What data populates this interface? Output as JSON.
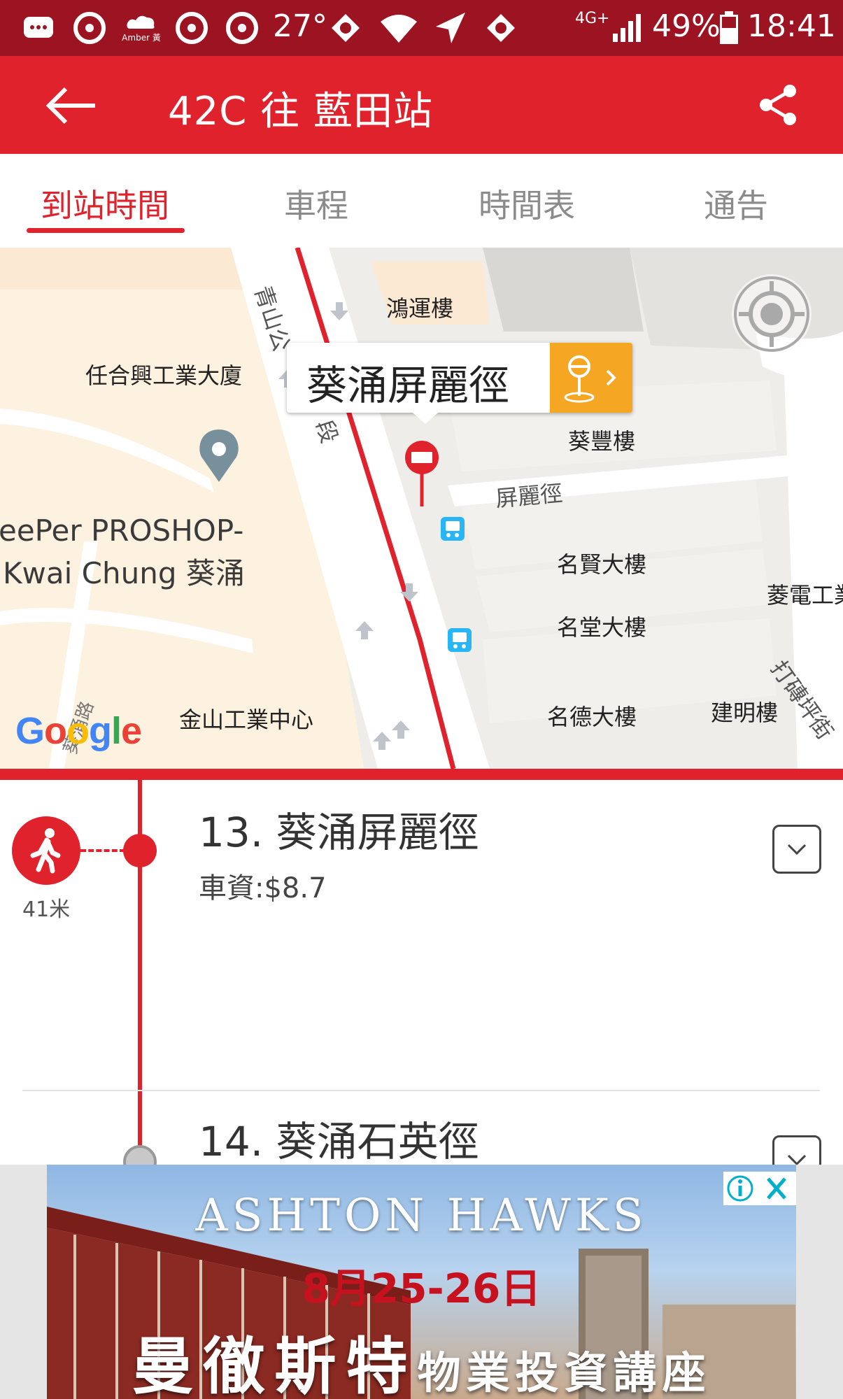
{
  "status_bar": {
    "temperature": "27°",
    "network": "4G+",
    "battery": "49%",
    "time": "18:41",
    "icons": [
      "message-icon",
      "typhoon-signal-icon",
      "amber-rainstorm-icon",
      "typhoon-signal-icon",
      "typhoon-signal-icon",
      "app-icon",
      "wifi-icon",
      "navigation-icon",
      "app-icon",
      "signal-icon",
      "battery-icon"
    ],
    "amber_text": "Amber 黃"
  },
  "app_bar": {
    "title": "42C 往 藍田站",
    "back_icon": "arrow-left-icon",
    "share_icon": "share-icon"
  },
  "tabs": [
    {
      "label": "到站時間",
      "active": true
    },
    {
      "label": "車程",
      "active": false
    },
    {
      "label": "時間表",
      "active": false
    },
    {
      "label": "通告",
      "active": false
    }
  ],
  "map": {
    "callout_title": "葵涌屏麗徑",
    "labels": {
      "hung_wan": "鴻運樓",
      "yam_hop": "任合興工業大廈",
      "tsing_shan_rd": "青山公",
      "section": "段",
      "kwai_fung": "葵豐樓",
      "ping_lai": "屏麗徑",
      "ming_yin": "名賢大樓",
      "ming_tong": "名堂大樓",
      "ming_tak": "名德大樓",
      "kin_ming": "建明樓",
      "kam_shan": "金山工業中心",
      "ling_din": "菱電工業",
      "ta_chuen": "打磚坪街",
      "kwai_road": "葵涌路",
      "proshop_1": "eePer PROSHOP-",
      "proshop_2": "Kwai Chung 葵涌"
    },
    "logo": "Google"
  },
  "stops": [
    {
      "title": "13. 葵涌屏麗徑",
      "fare": "車資:$8.7",
      "walk_distance": "41米"
    },
    {
      "title": "14. 葵涌石英徑"
    }
  ],
  "ad": {
    "headline": "ASHTON HAWKS",
    "date": "8月25-26日",
    "title_main": "曼徹斯特",
    "title_sub": "物業投資講座"
  },
  "colors": {
    "primary_red": "#e0222d",
    "status_bar": "#9c1321",
    "callout_orange": "#f5a623"
  }
}
